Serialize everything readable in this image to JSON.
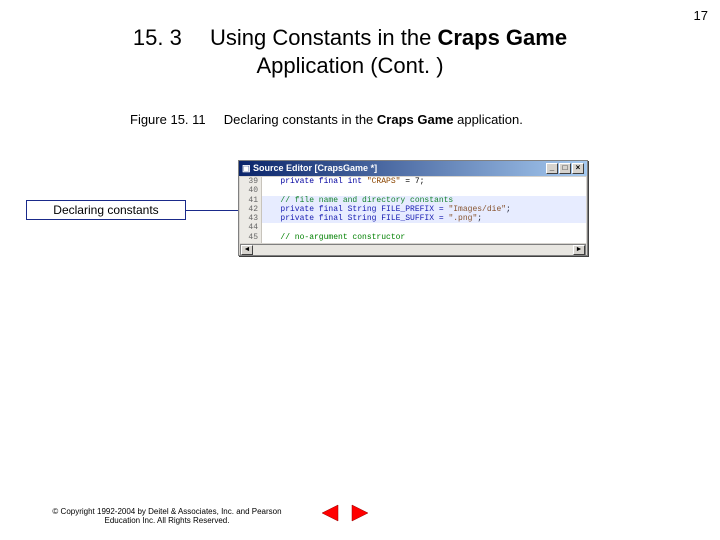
{
  "page_number": "17",
  "heading": {
    "secnum": "15. 3",
    "title_part1": "Using Constants in the ",
    "title_bold1": "Craps Game",
    "title_line2": "Application (Cont. )"
  },
  "figure": {
    "label": "Figure 15. 11",
    "desc_pre": "Declaring constants in the ",
    "desc_bold": "Craps Game",
    "desc_post": " application."
  },
  "callout": "Declaring constants",
  "editor": {
    "title": "Source Editor [CrapsGame *]",
    "gutter": [
      "39",
      "40",
      "41",
      "42",
      "43",
      "44",
      "45"
    ],
    "line39_a": "   private final int ",
    "line39_str": "\"CRAPS\"",
    "line39_b": " = 7;",
    "line41_cm": "   // file name and directory constants",
    "line42_a": "   private final String FILE_PREFIX = ",
    "line42_str": "\"Images/die\"",
    "line42_b": ";",
    "line43_a": "   private final String FILE_SUFFIX = ",
    "line43_str": "\".png\"",
    "line43_b": ";",
    "line45_cm": "   // no-argument constructor"
  },
  "footer": {
    "line1": "© Copyright 1992-2004 by Deitel & Associates, Inc. and Pearson",
    "line2": "Education Inc. All Rights Reserved."
  }
}
